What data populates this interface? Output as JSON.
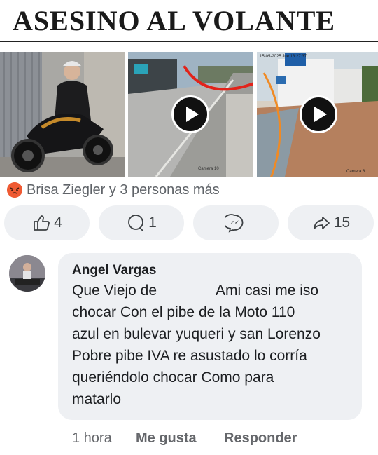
{
  "headline": {
    "title": "ASESINO AL VOLANTE"
  },
  "media": {
    "items": [
      {
        "kind": "photo",
        "description_icon": "person-on-motorcycle-photo"
      },
      {
        "kind": "video",
        "icon": "play-icon",
        "overlay_stamp": "Camera 10"
      },
      {
        "kind": "video",
        "icon": "play-icon",
        "overlay_stamp": "15-05-2025 Jue 13:27:37",
        "camera_label": "Camera 8"
      }
    ]
  },
  "reactions": {
    "text": "Brisa Ziegler y 3 personas más",
    "icon": "angry-reaction-icon"
  },
  "actions": {
    "like_count": "4",
    "comment_count": "1",
    "share_count": "15"
  },
  "comment": {
    "author": "Angel Vargas",
    "line1_a": "Que Viejo de",
    "line1_b": "Ami casi me iso",
    "line2": "chocar Con el pibe de la Moto 110",
    "line3": "azul en bulevar yuqueri y san Lorenzo",
    "line4": "Pobre pibe IVA re asustado lo corría",
    "line5": "queriéndolo chocar Como para",
    "line6": "matarlo",
    "time": "1 hora",
    "like_label": "Me gusta",
    "reply_label": "Responder"
  },
  "colors": {
    "bubble": "#eef0f3",
    "muted": "#65676b",
    "angry": "#f0643b"
  }
}
